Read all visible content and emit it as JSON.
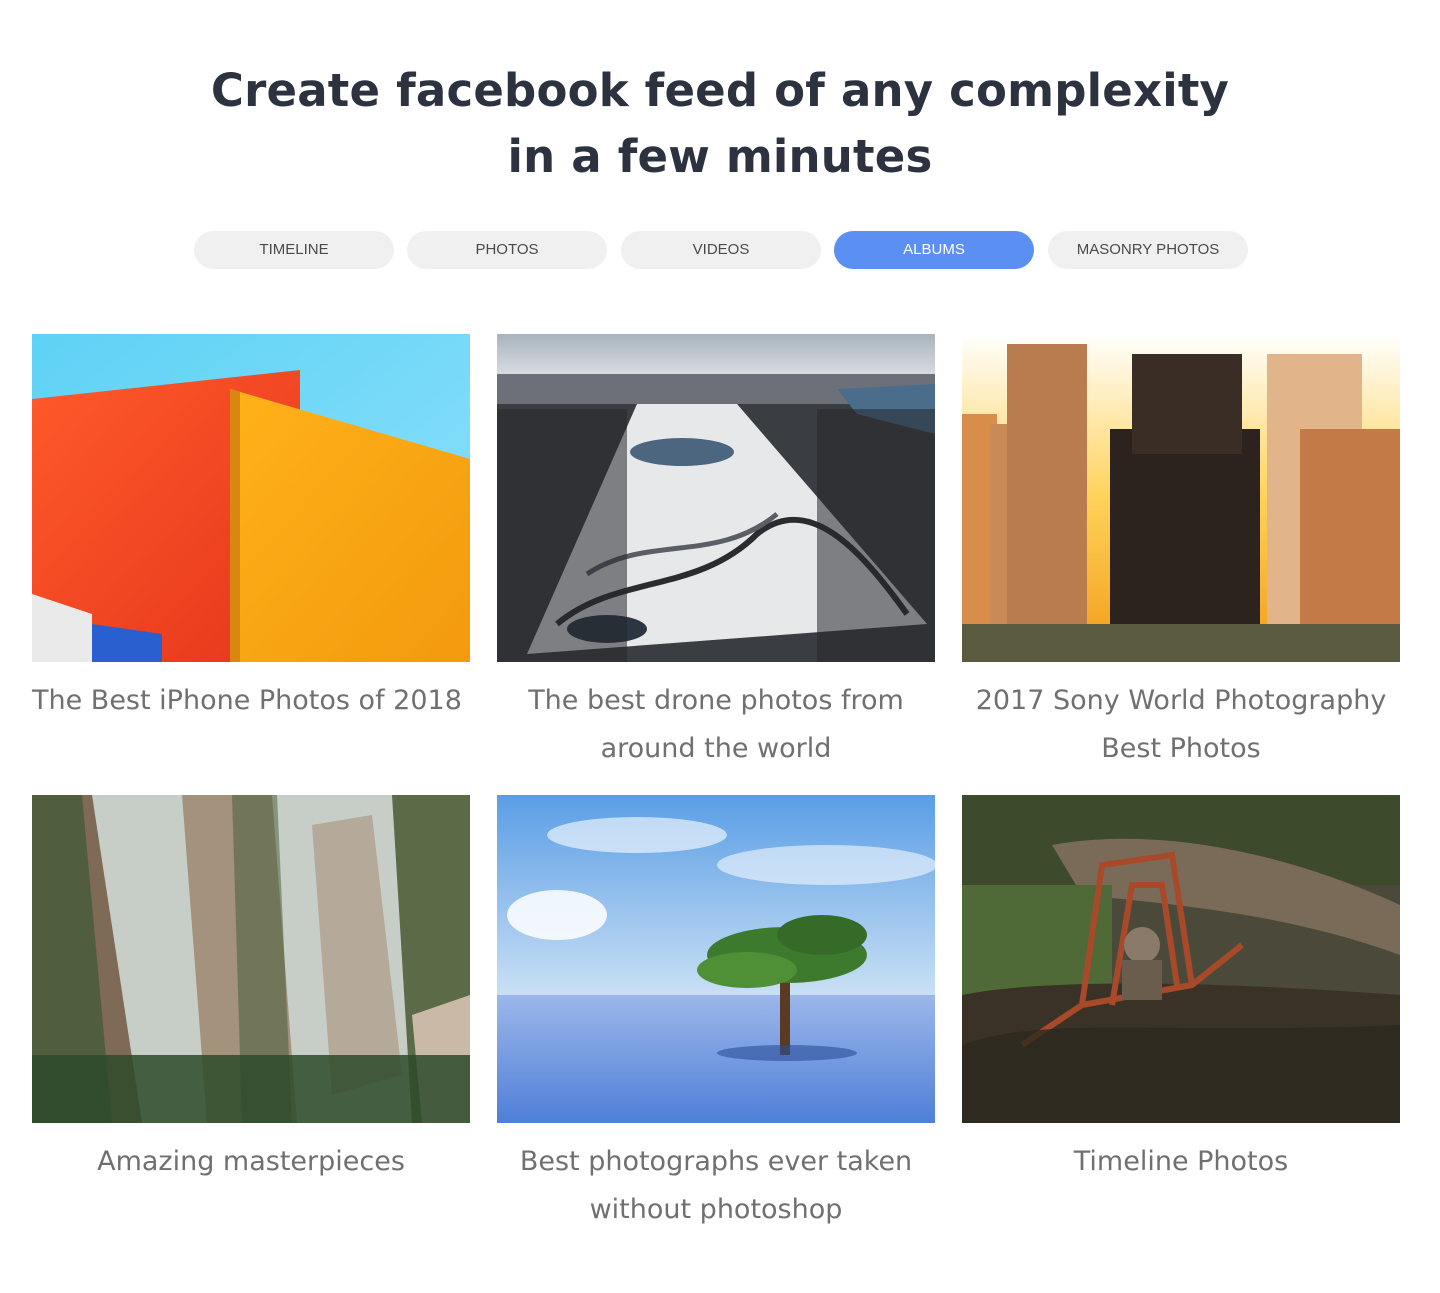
{
  "heading": {
    "line1": "Create facebook feed of any complexity",
    "line2": "in a few minutes"
  },
  "tabs": [
    {
      "label": "TIMELINE",
      "active": false
    },
    {
      "label": "PHOTOS",
      "active": false
    },
    {
      "label": "VIDEOS",
      "active": false
    },
    {
      "label": "ALBUMS",
      "active": true
    },
    {
      "label": "MASONRY PHOTOS",
      "active": false
    }
  ],
  "colors": {
    "accent": "#5b8ff2",
    "tab_bg": "#f0f0f0",
    "heading": "#2d3240",
    "caption": "#707070"
  },
  "albums": [
    {
      "title": "The Best iPhone Photos of 2018"
    },
    {
      "title": "The best drone photos from around the world"
    },
    {
      "title": "2017 Sony World Photography Best Photos"
    },
    {
      "title": "Amazing masterpieces"
    },
    {
      "title": "Best photographs ever taken without photoshop"
    },
    {
      "title": "Timeline Photos"
    }
  ]
}
